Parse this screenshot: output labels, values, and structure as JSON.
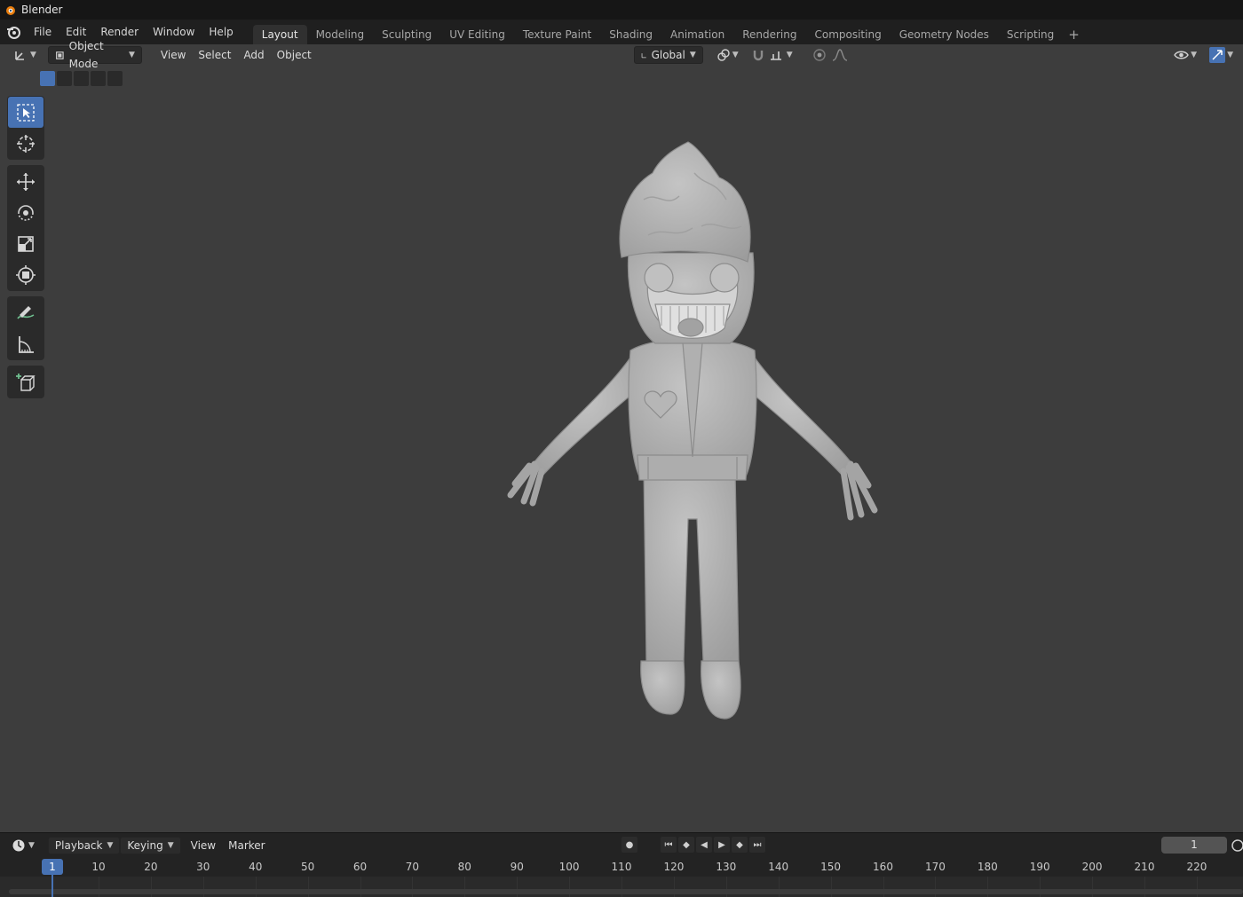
{
  "app": {
    "title": "Blender"
  },
  "menu": [
    "File",
    "Edit",
    "Render",
    "Window",
    "Help"
  ],
  "workspaces": {
    "active": "Layout",
    "tabs": [
      "Layout",
      "Modeling",
      "Sculpting",
      "UV Editing",
      "Texture Paint",
      "Shading",
      "Animation",
      "Rendering",
      "Compositing",
      "Geometry Nodes",
      "Scripting"
    ],
    "add_symbol": "+"
  },
  "viewport_header": {
    "mode": "Object Mode",
    "menus": [
      "View",
      "Select",
      "Add",
      "Object"
    ],
    "orientation": "Global"
  },
  "tools": [
    {
      "name": "select-box",
      "icon": "select-box-icon",
      "active": true
    },
    {
      "name": "cursor",
      "icon": "cursor-icon",
      "active": false
    },
    {
      "name": "move",
      "icon": "move-icon",
      "active": false
    },
    {
      "name": "rotate",
      "icon": "rotate-icon",
      "active": false
    },
    {
      "name": "scale",
      "icon": "scale-icon",
      "active": false
    },
    {
      "name": "transform",
      "icon": "transform-icon",
      "active": false
    },
    {
      "name": "annotate",
      "icon": "annotate-icon",
      "active": false
    },
    {
      "name": "measure",
      "icon": "measure-icon",
      "active": false
    },
    {
      "name": "add-cube",
      "icon": "add-cube-icon",
      "active": false
    }
  ],
  "timeline": {
    "menus": [
      "Playback",
      "Keying",
      "View",
      "Marker"
    ],
    "current_frame": "1",
    "ruler_labels": [
      "1",
      "10",
      "20",
      "30",
      "40",
      "50",
      "60",
      "70",
      "80",
      "90",
      "100",
      "110",
      "120",
      "130",
      "140",
      "150",
      "160",
      "170",
      "180",
      "190",
      "200",
      "210",
      "220"
    ]
  },
  "colors": {
    "accent": "#4772b3",
    "viewport_bg": "#3d3d3d",
    "model": "#b4b4b4"
  }
}
